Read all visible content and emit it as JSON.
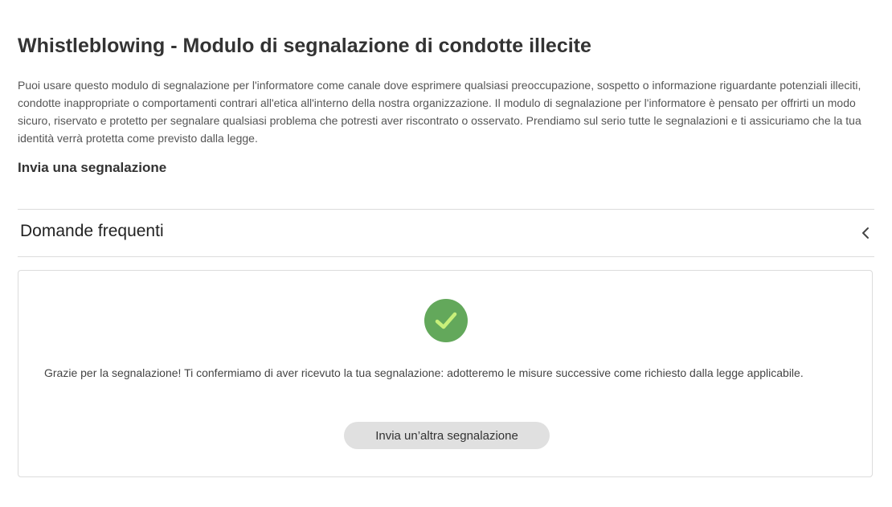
{
  "header": {
    "title": "Whistleblowing - Modulo di segnalazione di condotte illecite",
    "intro": "Puoi usare questo modulo di segnalazione per l'informatore come canale dove esprimere qualsiasi preoccupazione, sospetto o informazione riguardante potenziali illeciti, condotte inappropriate o comportamenti contrari all'etica all'interno della nostra organizzazione. Il modulo di segnalazione per l'informatore è pensato per offrirti un modo sicuro, riservato e protetto per segnalare qualsiasi problema che potresti aver riscontrato o osservato. Prendiamo sul serio tutte le segnalazioni e ti assicuriamo che la tua identità verrà protetta come previsto dalla legge.",
    "submit_link": "Invia una segnalazione"
  },
  "faq": {
    "label": "Domande frequenti",
    "icon": "chevron-left-icon",
    "expanded": false
  },
  "confirmation": {
    "icon": "check-circle-icon",
    "message": "Grazie per la segnalazione! Ti confermiamo di aver ricevuto la tua segnalazione: adotteremo le misure successive come richiesto dalla legge applicabile.",
    "button_label": "Invia un’altra segnalazione"
  },
  "colors": {
    "success": "#63a85b",
    "check_mark": "#c8f07a",
    "button_bg": "#e0e0e0",
    "divider": "#dcdcdc"
  }
}
